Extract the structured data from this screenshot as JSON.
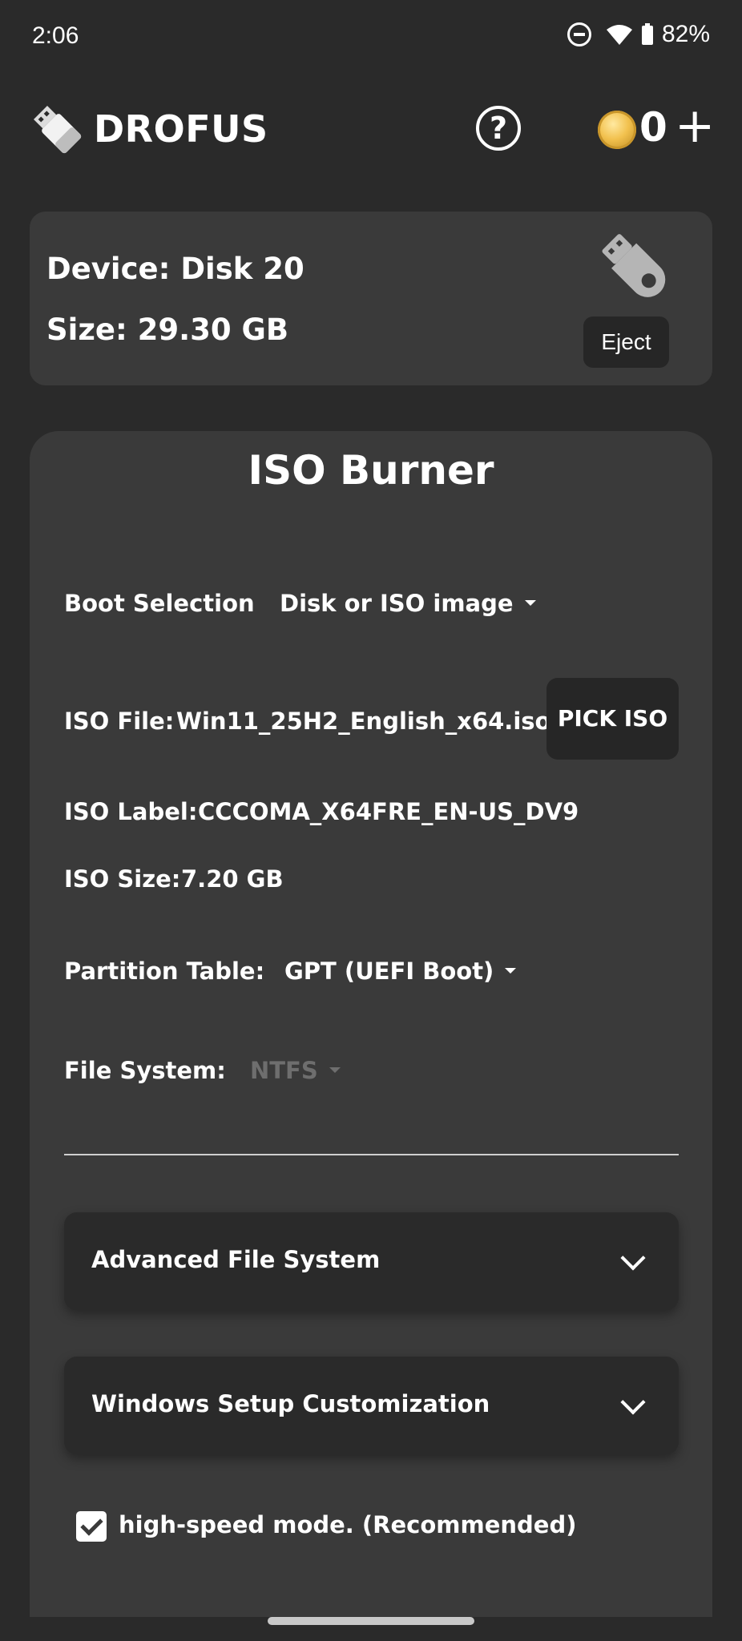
{
  "status_bar": {
    "time": "2:06",
    "battery": "82%"
  },
  "header": {
    "app_title": "DROFUS",
    "help_icon": "?",
    "coin_count": "0",
    "add_label": "+"
  },
  "device": {
    "name_label": "Device: Disk 20",
    "size_label": "Size: 29.30 GB",
    "eject_label": "Eject"
  },
  "burner": {
    "title": "ISO Burner",
    "boot_selection": {
      "label": "Boot Selection",
      "value": "Disk or ISO image"
    },
    "iso_file": {
      "label": "ISO File:",
      "value": "Win11_25H2_English_x64.iso",
      "pick_label": "PICK ISO"
    },
    "iso_label": {
      "label": "ISO Label:",
      "value": "CCCOMA_X64FRE_EN-US_DV9"
    },
    "iso_size": {
      "label": "ISO Size:",
      "value": "7.20 GB"
    },
    "partition_table": {
      "label": "Partition Table:",
      "value": "GPT (UEFI Boot)"
    },
    "file_system": {
      "label": "File System:",
      "value": "NTFS"
    },
    "accordions": [
      {
        "label": "Advanced File System"
      },
      {
        "label": "Windows Setup Customization"
      }
    ],
    "high_speed": {
      "label": "high-speed mode. (Recommended)",
      "checked": true
    }
  },
  "colors": {
    "background": "#2a2a2a",
    "card": "#3a3a3a",
    "button": "#262626",
    "disabled_text": "#6e6e6e",
    "coin": "#f2c14e"
  }
}
